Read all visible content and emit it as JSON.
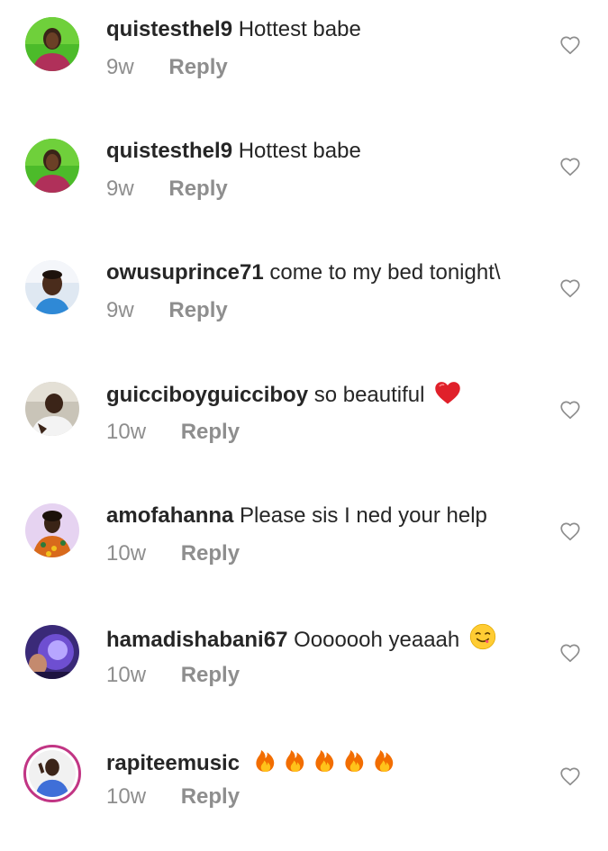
{
  "comments": [
    {
      "username": "quistesthel9",
      "text": "Hottest babe",
      "emoji": "",
      "time": "9w",
      "reply_label": "Reply",
      "avatar": "green-portrait"
    },
    {
      "username": "quistesthel9",
      "text": "Hottest babe",
      "emoji": "",
      "time": "9w",
      "reply_label": "Reply",
      "avatar": "green-portrait"
    },
    {
      "username": "owusuprince71",
      "text": "come to my bed tonight\\",
      "emoji": "",
      "time": "9w",
      "reply_label": "Reply",
      "avatar": "man-blue"
    },
    {
      "username": "guicciboyguicciboy",
      "text": "so beautiful",
      "emoji": "red-heart",
      "time": "10w",
      "reply_label": "Reply",
      "avatar": "man-white"
    },
    {
      "username": "amofahanna",
      "text": "Please sis I ned your help",
      "emoji": "",
      "time": "10w",
      "reply_label": "Reply",
      "avatar": "woman-patterned"
    },
    {
      "username": "hamadishabani67",
      "text": "Ooooooh yeaaah",
      "emoji": "savoring-face",
      "time": "10w",
      "reply_label": "Reply",
      "avatar": "purple-glow"
    },
    {
      "username": "rapiteemusic",
      "text": "",
      "emoji": "fire x5",
      "time": "10w",
      "reply_label": "Reply",
      "avatar": "man-story-ring"
    }
  ],
  "colors": {
    "primary_text": "#262626",
    "secondary_text": "#8e8e8e",
    "heart_outline": "#8e8e8e",
    "story_ring": "#c13584"
  }
}
